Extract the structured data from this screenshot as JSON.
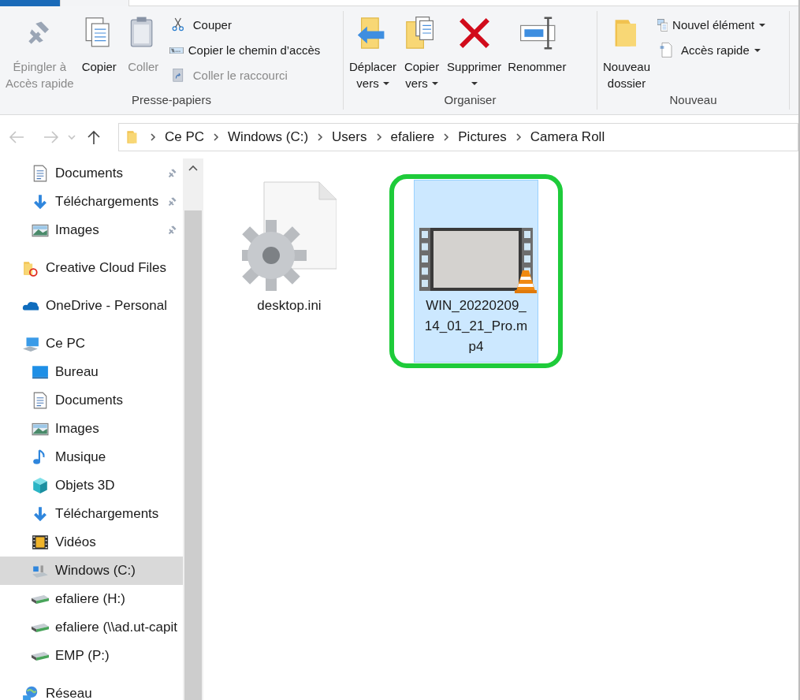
{
  "ribbon": {
    "groups": [
      {
        "label": "Presse-papiers",
        "commands": [
          {
            "kind": "large",
            "label": "Épingler à\nAccès rapide",
            "disabled": true,
            "dropdown": false
          },
          {
            "kind": "large",
            "label": "Copier",
            "disabled": false,
            "dropdown": false
          },
          {
            "kind": "large",
            "label": "Coller",
            "disabled": true,
            "dropdown": false
          },
          {
            "kind": "small",
            "label": "Couper",
            "disabled": false,
            "dropdown": false
          },
          {
            "kind": "small",
            "label": "Copier le chemin d’accès",
            "disabled": false,
            "dropdown": false
          },
          {
            "kind": "small",
            "label": "Coller le raccourci",
            "disabled": true,
            "dropdown": false
          }
        ]
      },
      {
        "label": "Organiser",
        "commands": [
          {
            "kind": "large",
            "label": "Déplacer\nvers",
            "disabled": false,
            "dropdown": true
          },
          {
            "kind": "large",
            "label": "Copier\nvers",
            "disabled": false,
            "dropdown": true
          },
          {
            "kind": "large",
            "label": "Supprimer",
            "disabled": false,
            "dropdown": true
          },
          {
            "kind": "large",
            "label": "Renommer",
            "disabled": false,
            "dropdown": false
          }
        ]
      },
      {
        "label": "Nouveau",
        "commands": [
          {
            "kind": "large",
            "label": "Nouveau\ndossier",
            "disabled": false,
            "dropdown": false
          },
          {
            "kind": "small",
            "label": "Nouvel élément",
            "disabled": false,
            "dropdown": true
          },
          {
            "kind": "small",
            "label": "Accès rapide",
            "disabled": false,
            "dropdown": true
          }
        ]
      }
    ]
  },
  "navigation": {
    "back_disabled": true,
    "forward_disabled": true
  },
  "breadcrumbs": [
    "Ce PC",
    "Windows (C:)",
    "Users",
    "efaliere",
    "Pictures",
    "Camera Roll"
  ],
  "sidebar": {
    "pinned_items": [
      {
        "kind": "documents",
        "label": "Documents",
        "pinned": true
      },
      {
        "kind": "downloads",
        "label": "Téléchargements",
        "pinned": true
      },
      {
        "kind": "pictures",
        "label": "Images",
        "pinned": true
      }
    ],
    "items": [
      {
        "kind": "cloudfolder",
        "label": "Creative Cloud Files",
        "selected": false
      },
      {
        "kind": "onedrive",
        "label": "OneDrive - Personal",
        "selected": false
      },
      {
        "kind": "pc",
        "label": "Ce PC",
        "selected": false,
        "children": [
          {
            "kind": "desktop",
            "label": "Bureau",
            "selected": false
          },
          {
            "kind": "documents",
            "label": "Documents",
            "selected": false
          },
          {
            "kind": "pictures",
            "label": "Images",
            "selected": false
          },
          {
            "kind": "music",
            "label": "Musique",
            "selected": false
          },
          {
            "kind": "objects3d",
            "label": "Objets 3D",
            "selected": false
          },
          {
            "kind": "downloads",
            "label": "Téléchargements",
            "selected": false
          },
          {
            "kind": "videos",
            "label": "Vidéos",
            "selected": false
          },
          {
            "kind": "osdrive",
            "label": "Windows (C:)",
            "selected": true
          },
          {
            "kind": "netdrive",
            "label": "efaliere (H:)",
            "selected": false
          },
          {
            "kind": "netdrive",
            "label": "efaliere (\\\\ad.ut-capit",
            "selected": false
          },
          {
            "kind": "netdrive",
            "label": "EMP (P:)",
            "selected": false
          }
        ]
      },
      {
        "kind": "network",
        "label": "Réseau",
        "selected": false
      }
    ]
  },
  "files": [
    {
      "kind": "settings",
      "name": "desktop.ini",
      "selected": false,
      "highlighted": false
    },
    {
      "kind": "video",
      "name": "WIN_20220209_14_01_21_Pro.mp4",
      "selected": true,
      "highlighted": true
    }
  ]
}
